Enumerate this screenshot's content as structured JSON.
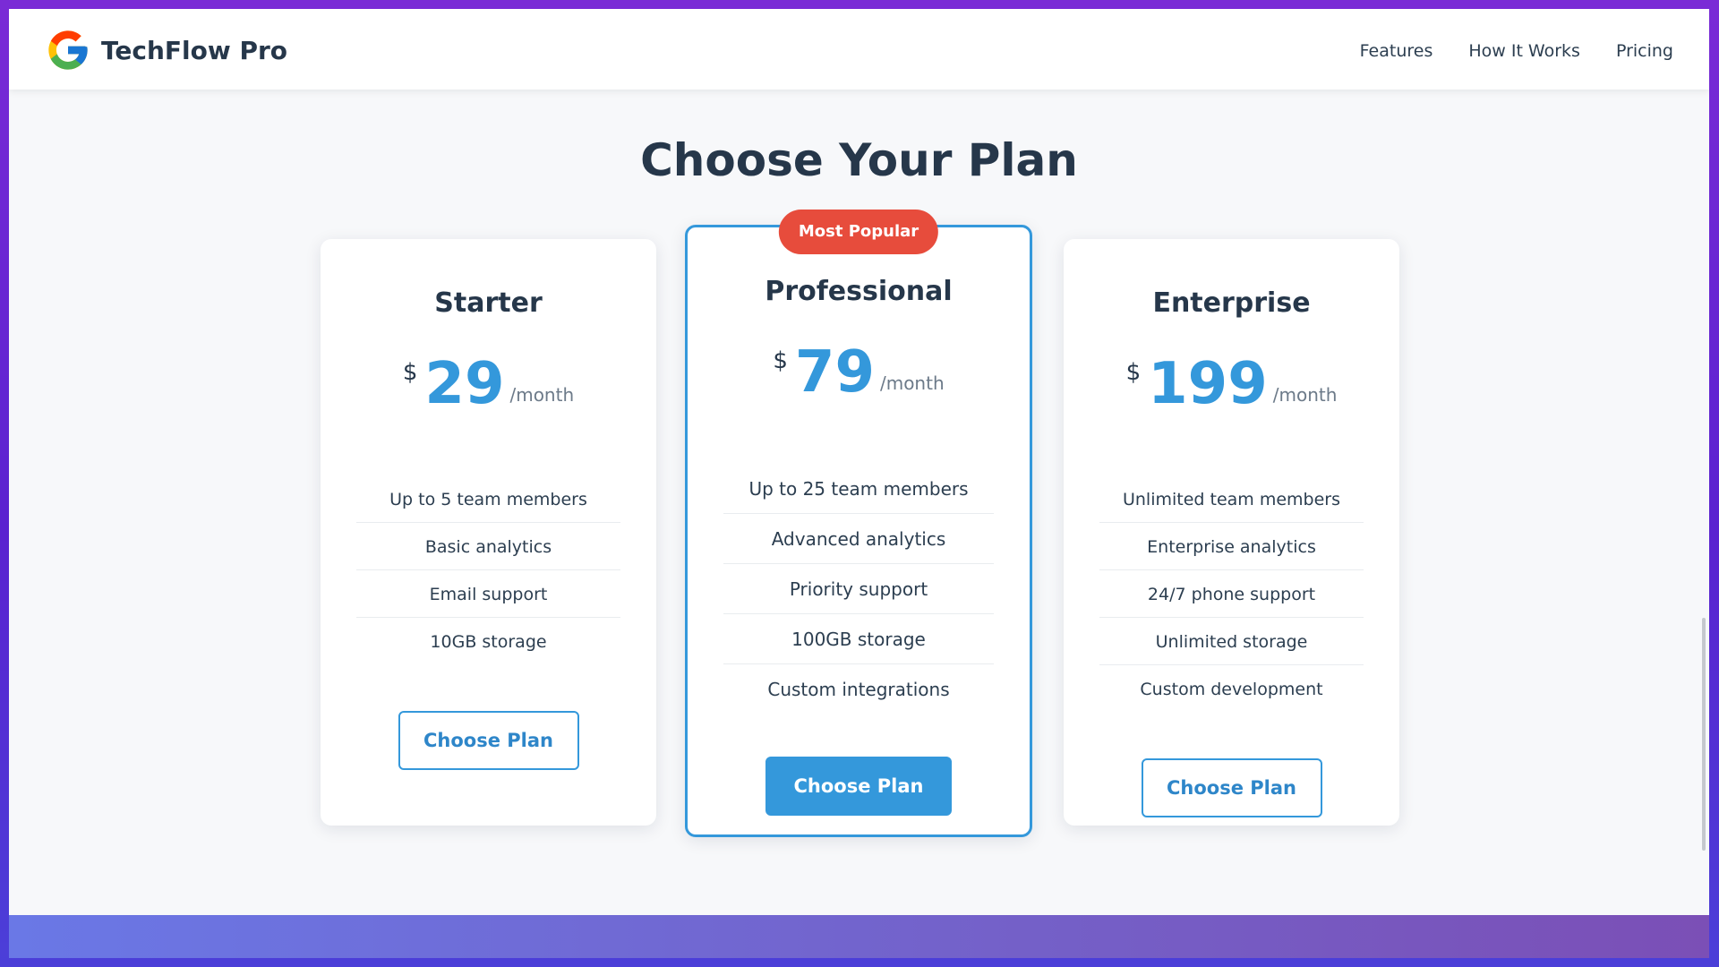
{
  "header": {
    "brand": "TechFlow Pro",
    "nav": [
      "Features",
      "How It Works",
      "Pricing"
    ]
  },
  "pricing": {
    "title": "Choose Your Plan",
    "plans": [
      {
        "name": "Starter",
        "currency": "$",
        "price": "29",
        "period": "/month",
        "features": [
          "Up to 5 team members",
          "Basic analytics",
          "Email support",
          "10GB storage"
        ],
        "cta": "Choose Plan"
      },
      {
        "name": "Professional",
        "badge": "Most Popular",
        "currency": "$",
        "price": "79",
        "period": "/month",
        "features": [
          "Up to 25 team members",
          "Advanced analytics",
          "Priority support",
          "100GB storage",
          "Custom integrations"
        ],
        "cta": "Choose Plan"
      },
      {
        "name": "Enterprise",
        "currency": "$",
        "price": "199",
        "period": "/month",
        "features": [
          "Unlimited team members",
          "Enterprise analytics",
          "24/7 phone support",
          "Unlimited storage",
          "Custom development"
        ],
        "cta": "Choose Plan"
      }
    ]
  },
  "colors": {
    "accent": "#3498db",
    "badge": "#e74c3c",
    "heading": "#26374a"
  }
}
